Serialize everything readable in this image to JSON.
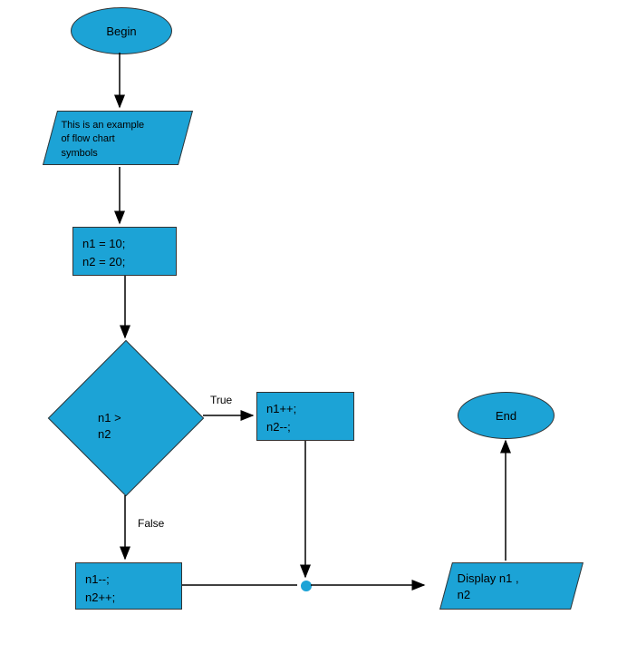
{
  "nodes": {
    "begin": "Begin",
    "io1_line1": "This is an example",
    "io1_line2": "of flow chart",
    "io1_line3": "symbols",
    "process1_line1": "n1 = 10;",
    "process1_line2": "n2 = 20;",
    "decision_line1": "n1 >",
    "decision_line2": "n2",
    "label_true": "True",
    "label_false": "False",
    "process_true_line1": "n1++;",
    "process_true_line2": "n2--;",
    "process_false_line1": "n1--;",
    "process_false_line2": "n2++;",
    "io2_line1": "Display n1 ,",
    "io2_line2": "n2",
    "end": "End"
  }
}
